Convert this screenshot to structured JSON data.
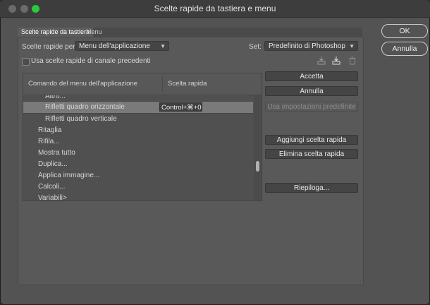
{
  "window": {
    "title": "Scelte rapide da tastiera e menu"
  },
  "tabs": [
    {
      "label": "Scelte rapide da tastiera"
    },
    {
      "label": "Menu"
    }
  ],
  "shortcuts_for": {
    "label": "Scelte rapide per:",
    "value": "Menu dell'applicazione"
  },
  "set": {
    "label": "Set:",
    "value": "Predefinito di Photoshop"
  },
  "legacy_channel": {
    "label": "Usa scelte rapide di canale precedenti",
    "checked": false
  },
  "table": {
    "headers": {
      "command": "Comando del menu dell'applicazione",
      "shortcut": "Scelta rapida"
    },
    "rows": [
      {
        "label": "Altro..."
      },
      {
        "label": "Rifletti quadro orizzontale",
        "shortcut": "Control+⌘+0"
      },
      {
        "label": "Rifletti quadro verticale"
      },
      {
        "label": "Ritaglia"
      },
      {
        "label": "Rifila..."
      },
      {
        "label": "Mostra tutto"
      },
      {
        "label": "Duplica..."
      },
      {
        "label": "Applica immagine..."
      },
      {
        "label": "Calcoli..."
      },
      {
        "label": "Variabili>"
      }
    ]
  },
  "buttons": {
    "accept": "Accetta",
    "cancel": "Annulla",
    "use_defaults": "Usa impostazioni predefinite",
    "add_shortcut": "Aggiungi scelta rapida",
    "delete_shortcut": "Elimina scelta rapida",
    "summarize": "Riepiloga...",
    "ok": "OK",
    "dialog_cancel": "Annulla"
  },
  "icons": {
    "save_set": "save-set-icon",
    "save_as": "save-as-icon",
    "delete_set": "trash-icon"
  }
}
